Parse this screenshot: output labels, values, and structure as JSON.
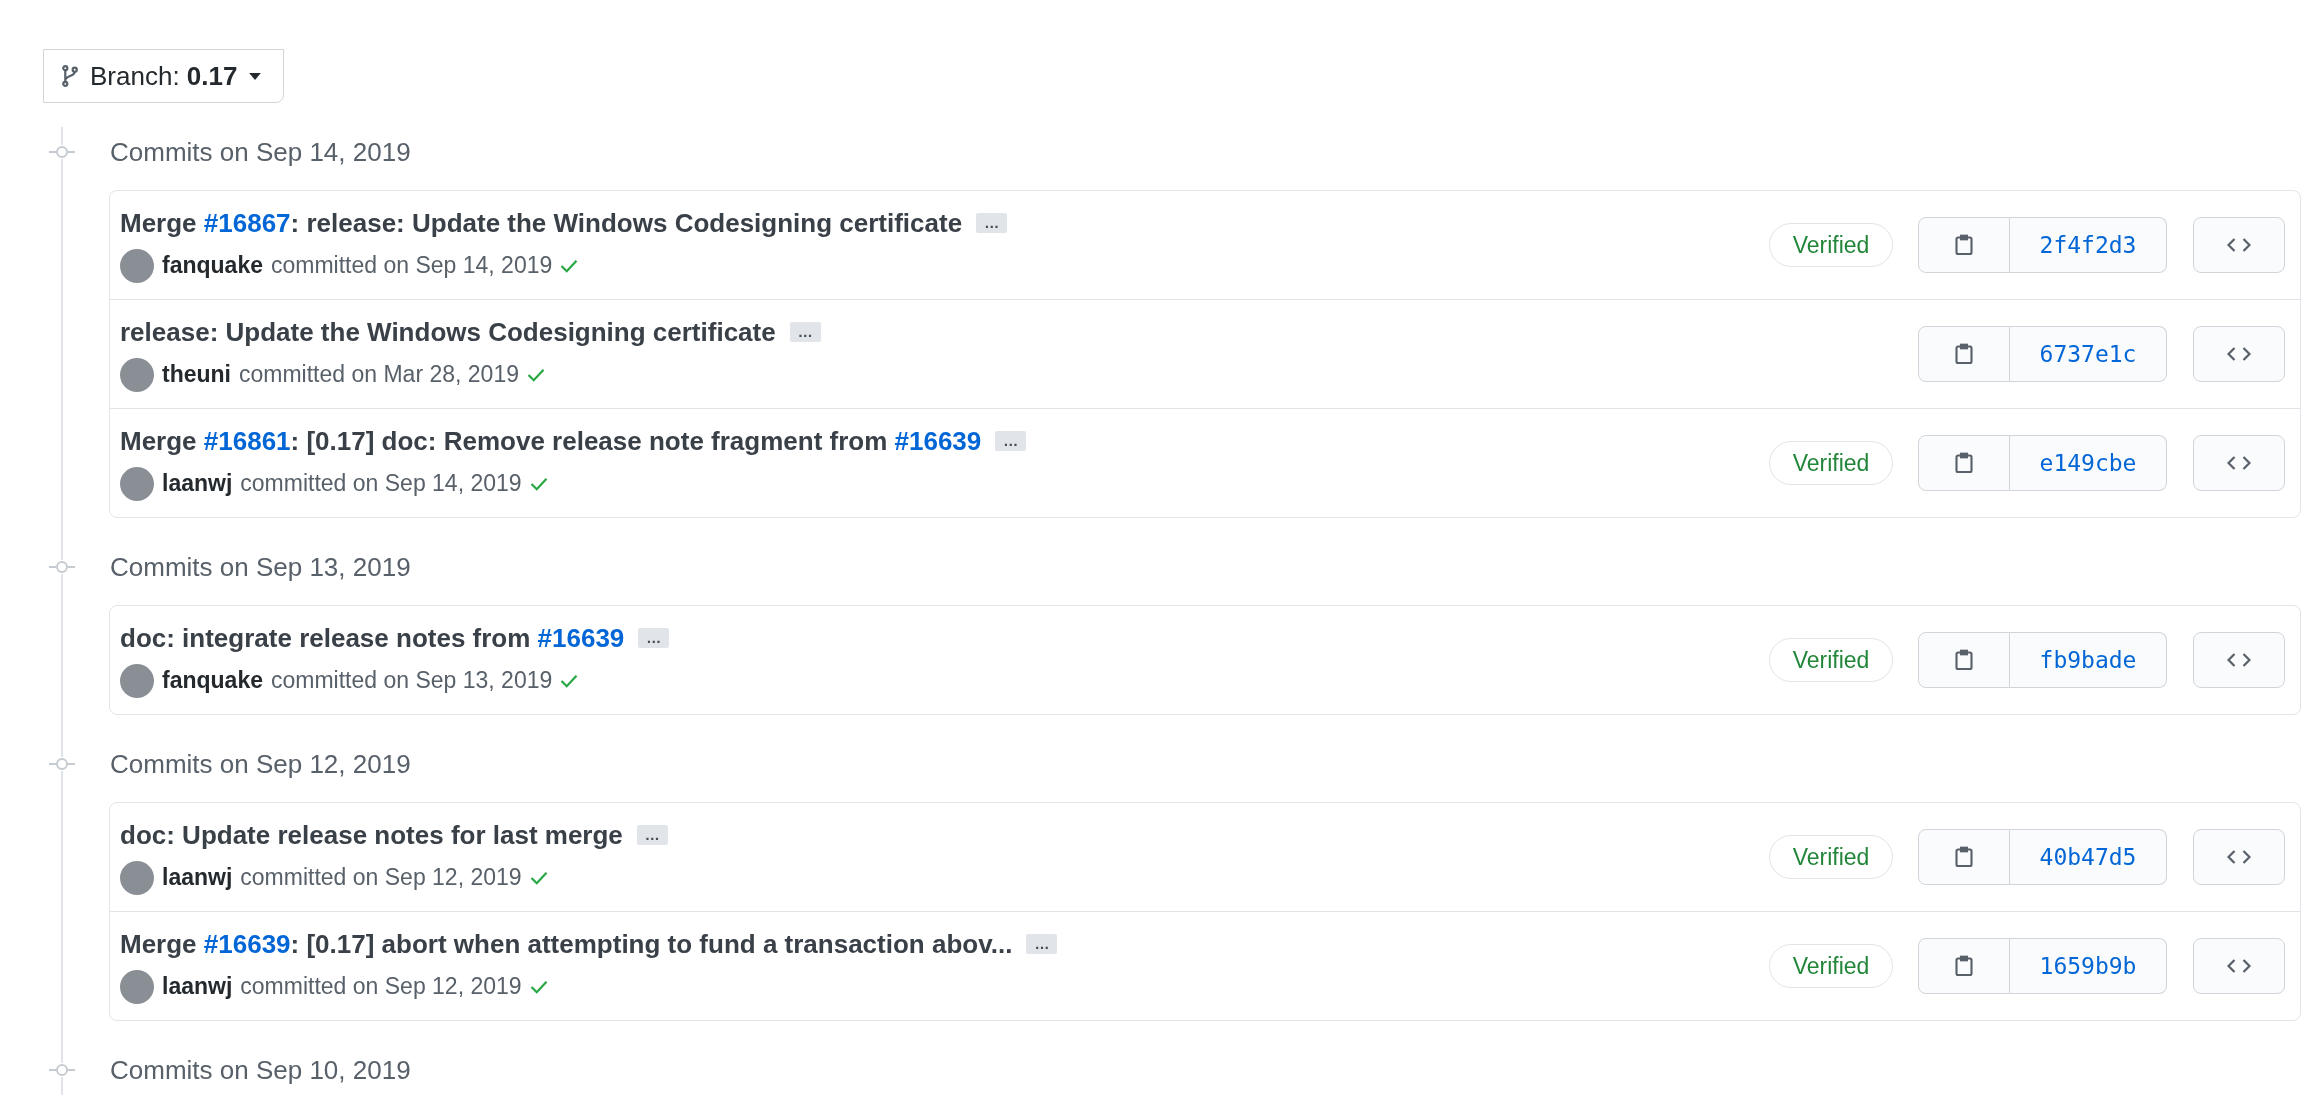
{
  "branch": {
    "label": "Branch:",
    "value": "0.17"
  },
  "groups": [
    {
      "heading": "Commits on Sep 14, 2019",
      "commits": [
        {
          "title": [
            {
              "kind": "text",
              "text": "Merge "
            },
            {
              "kind": "link",
              "text": "#16867"
            },
            {
              "kind": "text",
              "text": ": release: Update the Windows Codesigning certificate"
            }
          ],
          "ellipsis": "…",
          "author": "fanquake",
          "when": "committed on Sep 14, 2019",
          "checks_passed": true,
          "verified": true,
          "verified_label": "Verified",
          "hash": "2f4f2d3"
        },
        {
          "title": [
            {
              "kind": "text",
              "text": "release: Update the Windows Codesigning certificate"
            }
          ],
          "ellipsis": "…",
          "author": "theuni",
          "when": "committed on Mar 28, 2019",
          "checks_passed": true,
          "verified": false,
          "hash": "6737e1c"
        },
        {
          "title": [
            {
              "kind": "text",
              "text": "Merge "
            },
            {
              "kind": "link",
              "text": "#16861"
            },
            {
              "kind": "text",
              "text": ": [0.17] doc: Remove release note fragment from "
            },
            {
              "kind": "link",
              "text": "#16639"
            }
          ],
          "ellipsis": "…",
          "author": "laanwj",
          "when": "committed on Sep 14, 2019",
          "checks_passed": true,
          "verified": true,
          "verified_label": "Verified",
          "hash": "e149cbe"
        }
      ]
    },
    {
      "heading": "Commits on Sep 13, 2019",
      "commits": [
        {
          "title": [
            {
              "kind": "text",
              "text": "doc: integrate release notes from "
            },
            {
              "kind": "link",
              "text": "#16639"
            }
          ],
          "ellipsis": "…",
          "author": "fanquake",
          "when": "committed on Sep 13, 2019",
          "checks_passed": true,
          "verified": true,
          "verified_label": "Verified",
          "hash": "fb9bade"
        }
      ]
    },
    {
      "heading": "Commits on Sep 12, 2019",
      "commits": [
        {
          "title": [
            {
              "kind": "text",
              "text": "doc: Update release notes for last merge"
            }
          ],
          "ellipsis": "…",
          "author": "laanwj",
          "when": "committed on Sep 12, 2019",
          "checks_passed": true,
          "verified": true,
          "verified_label": "Verified",
          "hash": "40b47d5"
        },
        {
          "title": [
            {
              "kind": "text",
              "text": "Merge "
            },
            {
              "kind": "link",
              "text": "#16639"
            },
            {
              "kind": "text",
              "text": ": [0.17] abort when attempting to fund a transaction abov..."
            }
          ],
          "ellipsis": "…",
          "author": "laanwj",
          "when": "committed on Sep 12, 2019",
          "checks_passed": true,
          "verified": true,
          "verified_label": "Verified",
          "hash": "1659b9b"
        }
      ]
    },
    {
      "heading": "Commits on Sep 10, 2019"
    }
  ]
}
